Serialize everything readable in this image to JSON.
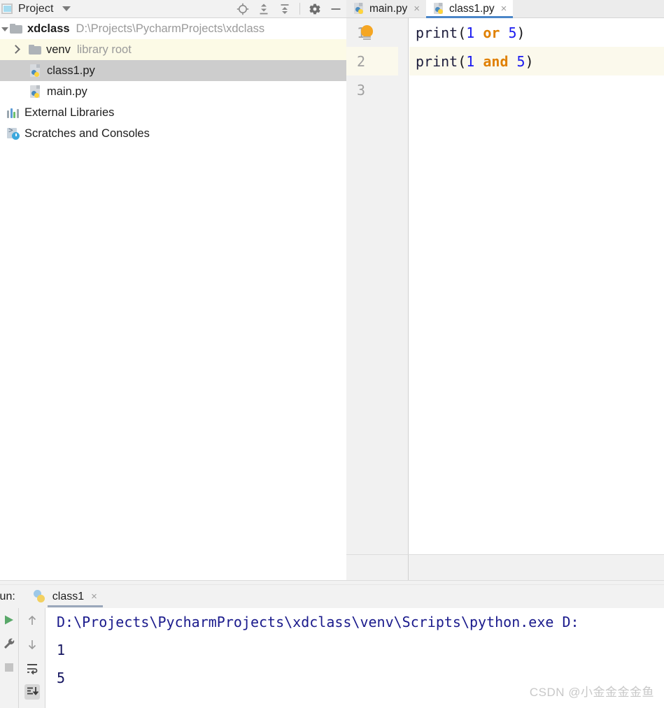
{
  "project_tool_window": {
    "title": "Project",
    "window_icon": "project-window-icon",
    "chevron_icon": "chevron-down-icon",
    "toolbar": [
      {
        "name": "locate-icon",
        "label": "Select Opened File"
      },
      {
        "name": "expand-all-icon",
        "label": "Expand All"
      },
      {
        "name": "collapse-all-icon",
        "label": "Collapse All"
      },
      {
        "name": "gear-icon",
        "label": "Options"
      },
      {
        "name": "minimize-icon",
        "label": "Hide"
      }
    ],
    "tree": [
      {
        "name": "xdclass",
        "hint": "D:\\Projects\\PycharmProjects\\xdclass",
        "icon": "folder-icon",
        "arrow": "expanded",
        "depth": 0,
        "bold": true,
        "state": "normal"
      },
      {
        "name": "venv",
        "hint": "library root",
        "icon": "folder-icon",
        "arrow": "collapsed",
        "depth": 1,
        "bold": false,
        "state": "highlighted"
      },
      {
        "name": "class1.py",
        "hint": "",
        "icon": "python-file-icon",
        "arrow": "none",
        "depth": 2,
        "bold": false,
        "state": "selected"
      },
      {
        "name": "main.py",
        "hint": "",
        "icon": "python-file-icon",
        "arrow": "none",
        "depth": 2,
        "bold": false,
        "state": "normal"
      },
      {
        "name": "External Libraries",
        "hint": "",
        "icon": "external-libraries-icon",
        "arrow": "none",
        "depth": 1,
        "bold": false,
        "state": "normal"
      },
      {
        "name": "Scratches and Consoles",
        "hint": "",
        "icon": "scratches-icon",
        "arrow": "none",
        "depth": 1,
        "bold": false,
        "state": "normal"
      }
    ]
  },
  "editor": {
    "tabs": [
      {
        "label": "main.py",
        "icon": "python-file-icon",
        "active": false,
        "close_icon": "×"
      },
      {
        "label": "class1.py",
        "icon": "python-file-icon",
        "active": true,
        "close_icon": "×"
      }
    ],
    "active_tab_underline_color": "#4a86c8",
    "current_line_highlight_color": "#fbf9ec",
    "line_numbers": [
      "1",
      "2",
      "3"
    ],
    "intention_bulb_icon": "lightbulb-icon",
    "lines": [
      {
        "number": "1",
        "current": false,
        "has_bulb": true,
        "tokens": [
          {
            "text": "print",
            "type": "fn"
          },
          {
            "text": "(",
            "type": "pn"
          },
          {
            "text": "1",
            "type": "num"
          },
          {
            "text": " ",
            "type": "pn"
          },
          {
            "text": "or",
            "type": "kw"
          },
          {
            "text": " ",
            "type": "pn"
          },
          {
            "text": "5",
            "type": "num"
          },
          {
            "text": ")",
            "type": "pn"
          }
        ]
      },
      {
        "number": "2",
        "current": true,
        "has_bulb": false,
        "tokens": [
          {
            "text": "print",
            "type": "fn"
          },
          {
            "text": "(",
            "type": "pn"
          },
          {
            "text": "1",
            "type": "num"
          },
          {
            "text": " ",
            "type": "pn"
          },
          {
            "text": "and",
            "type": "kw"
          },
          {
            "text": " ",
            "type": "pn"
          },
          {
            "text": "5",
            "type": "num"
          },
          {
            "text": ")",
            "type": "pn"
          }
        ]
      },
      {
        "number": "3",
        "current": false,
        "has_bulb": false,
        "tokens": []
      }
    ],
    "colors": {
      "keyword": "#e08000",
      "number": "#1a1af0",
      "identifier": "#1d1d3c",
      "punctuation": "#17171c",
      "gutter_text": "#a0a0a0"
    }
  },
  "run_tool_window": {
    "label": "Run:",
    "tab": {
      "label": "class1",
      "icon": "python-icon",
      "close_icon": "×"
    },
    "left_toolbar": [
      {
        "name": "rerun-icon",
        "label": "Rerun"
      },
      {
        "name": "wrench-icon",
        "label": "Edit Configuration"
      },
      {
        "name": "stop-icon",
        "label": "Stop"
      }
    ],
    "secondary_toolbar": [
      {
        "name": "up-arrow-icon",
        "label": "Up the Stack Trace",
        "selected": false
      },
      {
        "name": "down-arrow-icon",
        "label": "Down the Stack Trace",
        "selected": false
      },
      {
        "name": "soft-wrap-icon",
        "label": "Soft-Wrap",
        "selected": false
      },
      {
        "name": "scroll-to-end-icon",
        "label": "Scroll to End",
        "selected": true
      }
    ],
    "console_lines": [
      {
        "text": "D:\\Projects\\PycharmProjects\\xdclass\\venv\\Scripts\\python.exe D:",
        "type": "cmd"
      },
      {
        "text": "1",
        "type": "out"
      },
      {
        "text": "5",
        "type": "out"
      }
    ]
  },
  "watermark": {
    "text": "CSDN @小金金金金鱼"
  }
}
